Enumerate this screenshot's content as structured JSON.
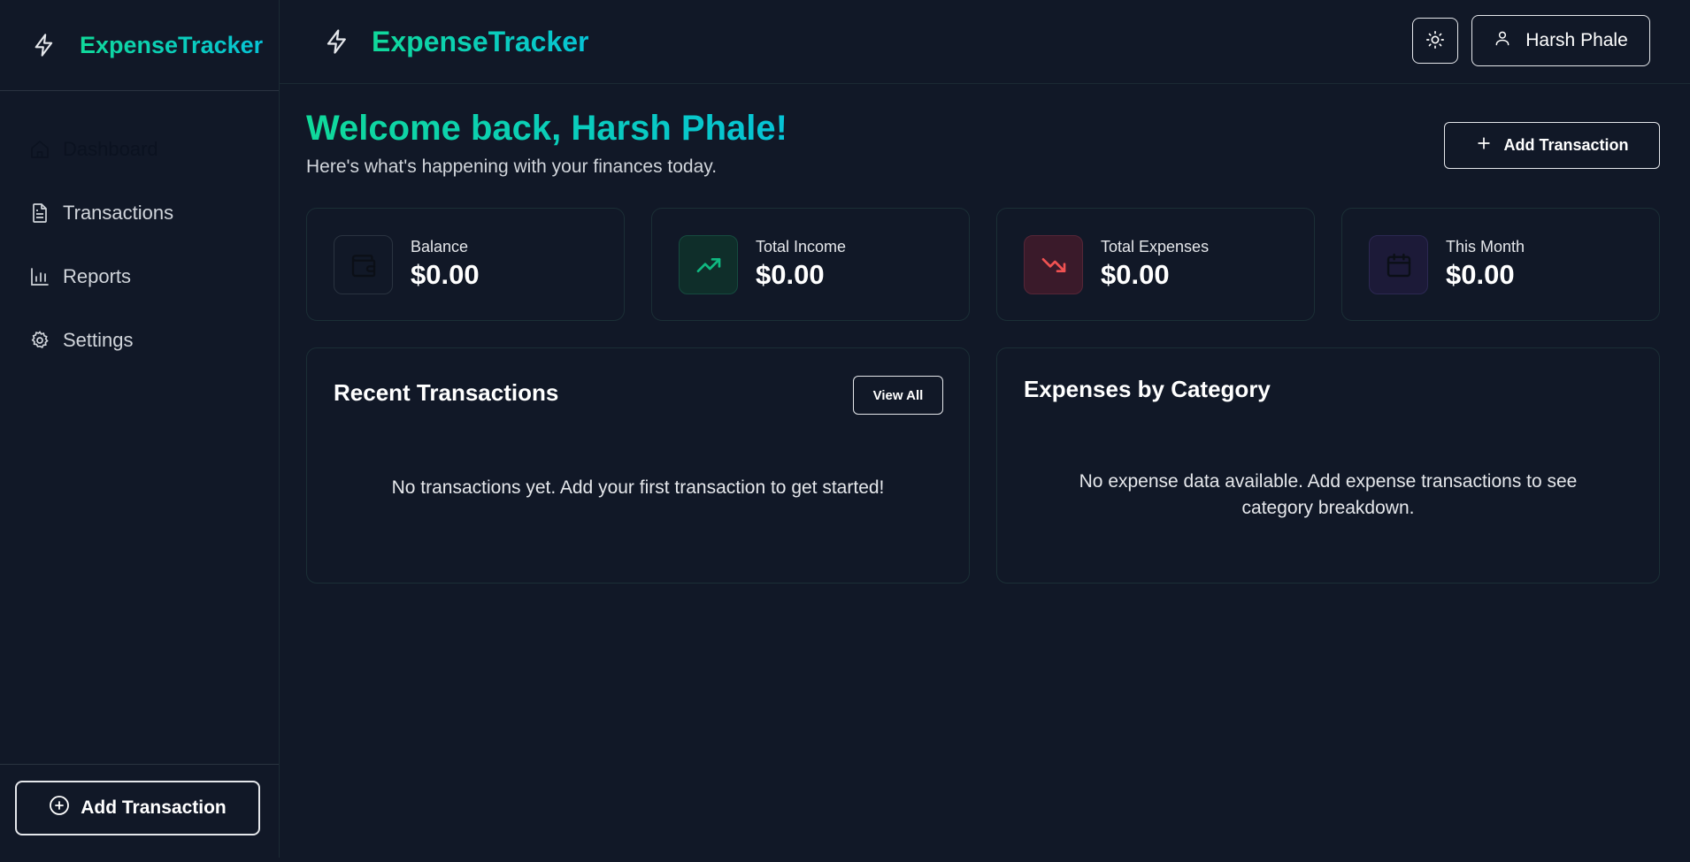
{
  "app": {
    "brand": "ExpenseTracker"
  },
  "sidebar": {
    "items": [
      {
        "label": "Dashboard",
        "icon": "home-icon",
        "active": true
      },
      {
        "label": "Transactions",
        "icon": "file-text-icon"
      },
      {
        "label": "Reports",
        "icon": "bar-chart-icon"
      },
      {
        "label": "Settings",
        "icon": "gear-icon"
      }
    ],
    "add_button": "Add Transaction"
  },
  "topbar": {
    "brand": "ExpenseTracker",
    "user_name": "Harsh Phale",
    "theme_icon": "sun-icon"
  },
  "main": {
    "welcome": "Welcome back, Harsh Phale!",
    "subtitle": "Here's what's happening with your finances today.",
    "add_button": "Add Transaction"
  },
  "stats": [
    {
      "label": "Balance",
      "value": "$0.00",
      "icon": "wallet-icon",
      "color": "#111827"
    },
    {
      "label": "Total Income",
      "value": "$0.00",
      "icon": "trending-up-icon",
      "color": "#10b981"
    },
    {
      "label": "Total Expenses",
      "value": "$0.00",
      "icon": "trending-down-icon",
      "color": "#f05252"
    },
    {
      "label": "This Month",
      "value": "$0.00",
      "icon": "calendar-icon",
      "color": "#1f1b3a"
    }
  ],
  "recent": {
    "title": "Recent Transactions",
    "view_all": "View All",
    "empty": "No transactions yet. Add your first transaction to get started!"
  },
  "category": {
    "title": "Expenses by Category",
    "empty": "No expense data available. Add expense transactions to see category breakdown."
  },
  "colors": {
    "accent_start": "#10d99a",
    "accent_end": "#06c3d6",
    "background": "#111827"
  }
}
